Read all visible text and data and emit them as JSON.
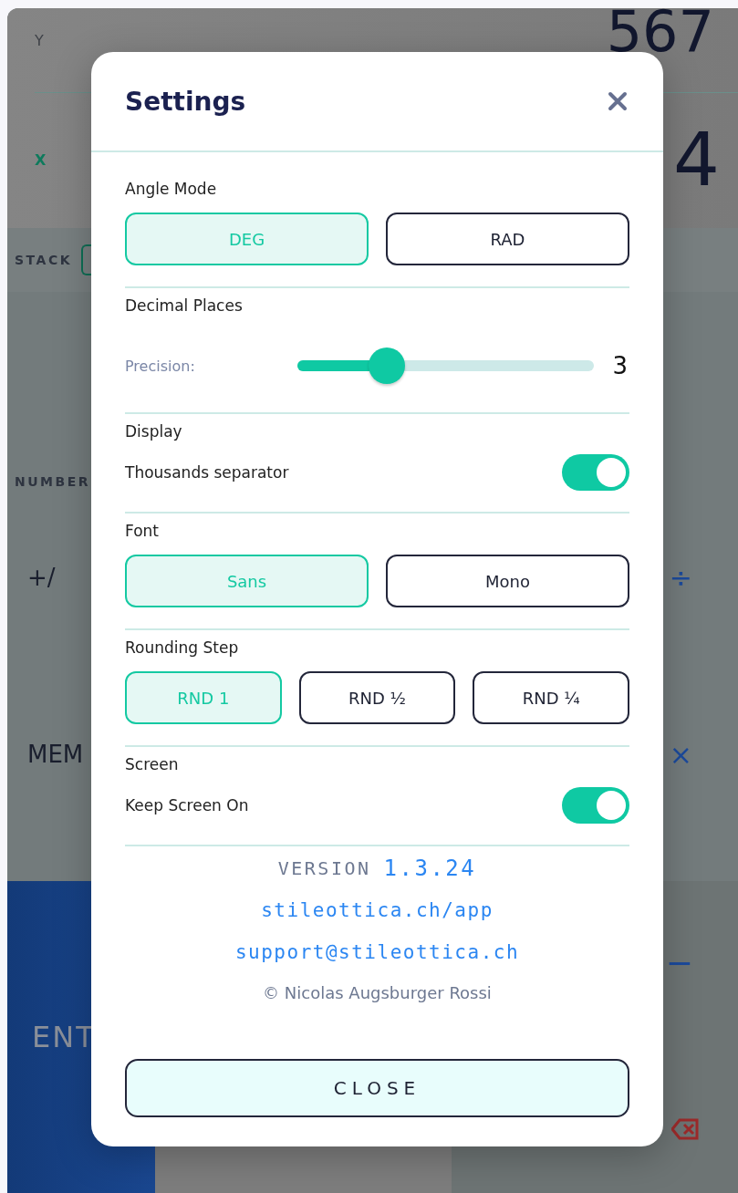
{
  "background": {
    "display": [
      {
        "label": "Y",
        "value": "567",
        "active": false
      },
      {
        "label": "X",
        "value": "4",
        "active": true
      }
    ],
    "stack_label": "STACK",
    "numbers_label": "NUMBER",
    "key_rows": [
      {
        "left": "+/",
        "right": "÷"
      },
      {
        "left": "MEM",
        "right": "×"
      }
    ],
    "enter_key": "ENT",
    "minus_key": "−"
  },
  "settings": {
    "title": "Settings",
    "sections": [
      {
        "kind": "choice",
        "title": "Angle Mode",
        "options": [
          {
            "label": "DEG",
            "selected": true
          },
          {
            "label": "RAD",
            "selected": false
          }
        ]
      },
      {
        "kind": "slider",
        "title": "Decimal Places",
        "label": "Precision:",
        "level": 0.3,
        "value": "3"
      },
      {
        "kind": "toggle",
        "title": "Display",
        "label": "Thousands separator",
        "on": true
      },
      {
        "kind": "choice",
        "title": "Font",
        "options": [
          {
            "label": "Sans",
            "selected": true
          },
          {
            "label": "Mono",
            "selected": false
          }
        ]
      },
      {
        "kind": "choice",
        "title": "Rounding Step",
        "options": [
          {
            "label": "RND 1",
            "selected": true
          },
          {
            "label": "RND ½",
            "selected": false
          },
          {
            "label": "RND ¼",
            "selected": false
          }
        ]
      },
      {
        "kind": "toggle",
        "title": "Screen",
        "label": "Keep Screen On",
        "on": true
      }
    ],
    "version_label": "VERSION",
    "version": "1.3.24",
    "links": [
      "stileottica.ch/app",
      "support@stileottica.ch"
    ],
    "copyright": "© Nicolas Augsburger Rossi",
    "close_button": "CLOSE"
  }
}
